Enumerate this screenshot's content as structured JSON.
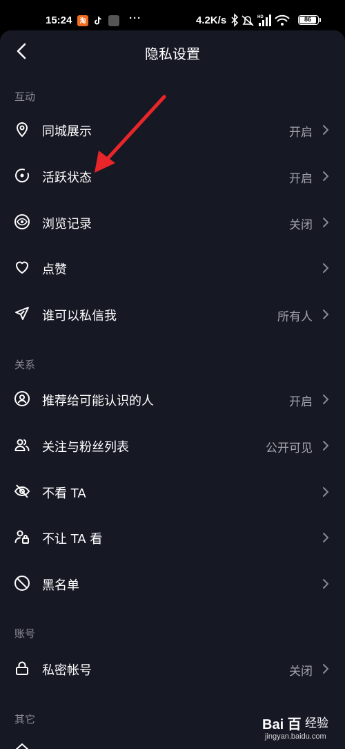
{
  "status_bar": {
    "time": "15:24",
    "dots": "···",
    "speed": "4.2K/s",
    "battery": "86",
    "app_icons": [
      "taobao-icon",
      "tiktok-icon",
      "generic-app-icon"
    ]
  },
  "header": {
    "title": "隐私设置",
    "back_icon": "back-arrow-icon"
  },
  "sections": [
    {
      "label": "互动",
      "rows": [
        {
          "label": "同城展示",
          "value": "开启",
          "icon": "location-pin-icon"
        },
        {
          "label": "活跃状态",
          "value": "开启",
          "icon": "activity-status-icon"
        },
        {
          "label": "浏览记录",
          "value": "关闭",
          "icon": "eye-icon"
        },
        {
          "label": "点赞",
          "value": "",
          "icon": "heart-icon"
        },
        {
          "label": "谁可以私信我",
          "value": "所有人",
          "icon": "paper-plane-icon"
        }
      ]
    },
    {
      "label": "关系",
      "rows": [
        {
          "label": "推荐给可能认识的人",
          "value": "开启",
          "icon": "user-circle-icon"
        },
        {
          "label": "关注与粉丝列表",
          "value": "公开可见",
          "icon": "users-icon"
        },
        {
          "label": "不看 TA",
          "value": "",
          "icon": "eye-off-icon"
        },
        {
          "label": "不让 TA 看",
          "value": "",
          "icon": "user-lock-icon"
        },
        {
          "label": "黑名单",
          "value": "",
          "icon": "block-icon"
        }
      ]
    },
    {
      "label": "账号",
      "rows": [
        {
          "label": "私密帐号",
          "value": "关闭",
          "icon": "lock-icon"
        }
      ]
    },
    {
      "label": "其它",
      "rows": []
    }
  ],
  "annotation": {
    "arrow_color": "#e8262a"
  },
  "watermark": {
    "logo": "Bai 百",
    "jingyan": "经验",
    "url": "jingyan.baidu.com"
  },
  "colors": {
    "background": "#161824",
    "text": "#ffffff",
    "secondary": "#a4a5ad",
    "section": "#8a8b94"
  }
}
